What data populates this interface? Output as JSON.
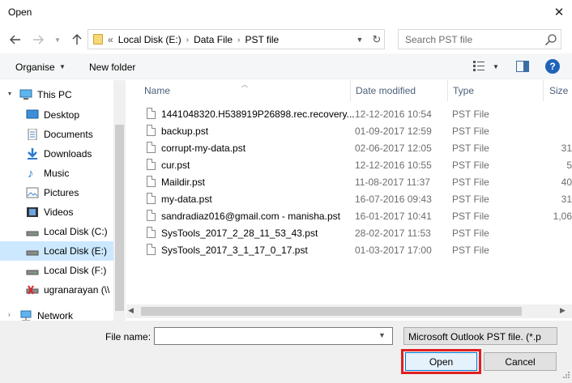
{
  "window": {
    "title": "Open",
    "close_icon": "close-icon"
  },
  "address": {
    "crumb_prefix": "«",
    "breadcrumbs": [
      "Local Disk (E:)",
      "Data File",
      "PST file"
    ],
    "search_placeholder": "Search PST file"
  },
  "toolbar": {
    "organise": "Organise",
    "new_folder": "New folder",
    "help": "?"
  },
  "nav": {
    "items": [
      {
        "label": "This PC",
        "icon": "this-pc-icon"
      },
      {
        "label": "Desktop",
        "icon": "desktop-icon"
      },
      {
        "label": "Documents",
        "icon": "documents-icon"
      },
      {
        "label": "Downloads",
        "icon": "downloads-icon"
      },
      {
        "label": "Music",
        "icon": "music-icon"
      },
      {
        "label": "Pictures",
        "icon": "pictures-icon"
      },
      {
        "label": "Videos",
        "icon": "videos-icon"
      },
      {
        "label": "Local Disk (C:)",
        "icon": "drive-icon"
      },
      {
        "label": "Local Disk (E:)",
        "icon": "drive-icon",
        "selected": true
      },
      {
        "label": "Local Disk (F:)",
        "icon": "drive-icon"
      },
      {
        "label": "ugranarayan (\\\\",
        "icon": "network-drive-icon"
      },
      {
        "label": "Network",
        "icon": "network-icon"
      }
    ]
  },
  "columns": {
    "name": "Name",
    "date": "Date modified",
    "type": "Type",
    "size": "Size"
  },
  "files": [
    {
      "name": "1441048320.H538919P26898.rec.recovery...",
      "date": "12-12-2016 10:54",
      "type": "PST File",
      "size": ""
    },
    {
      "name": "backup.pst",
      "date": "01-09-2017 12:59",
      "type": "PST File",
      "size": ""
    },
    {
      "name": "corrupt-my-data.pst",
      "date": "02-06-2017 12:05",
      "type": "PST File",
      "size": "31"
    },
    {
      "name": "cur.pst",
      "date": "12-12-2016 10:55",
      "type": "PST File",
      "size": "5"
    },
    {
      "name": "Maildir.pst",
      "date": "11-08-2017 11:37",
      "type": "PST File",
      "size": "40"
    },
    {
      "name": "my-data.pst",
      "date": "16-07-2016 09:43",
      "type": "PST File",
      "size": "31"
    },
    {
      "name": "sandradiaz016@gmail.com - manisha.pst",
      "date": "16-01-2017 10:41",
      "type": "PST File",
      "size": "1,06"
    },
    {
      "name": "SysTools_2017_2_28_11_53_43.pst",
      "date": "28-02-2017 11:53",
      "type": "PST File",
      "size": ""
    },
    {
      "name": "SysTools_2017_3_1_17_0_17.pst",
      "date": "01-03-2017 17:00",
      "type": "PST File",
      "size": ""
    }
  ],
  "bottom": {
    "file_name_label": "File name:",
    "file_name_value": "",
    "file_type": "Microsoft Outlook PST file. (*.p",
    "open": "Open",
    "cancel": "Cancel"
  },
  "colors": {
    "selection": "#cce8ff",
    "highlight_box": "#e02020",
    "accent": "#0078d7"
  }
}
